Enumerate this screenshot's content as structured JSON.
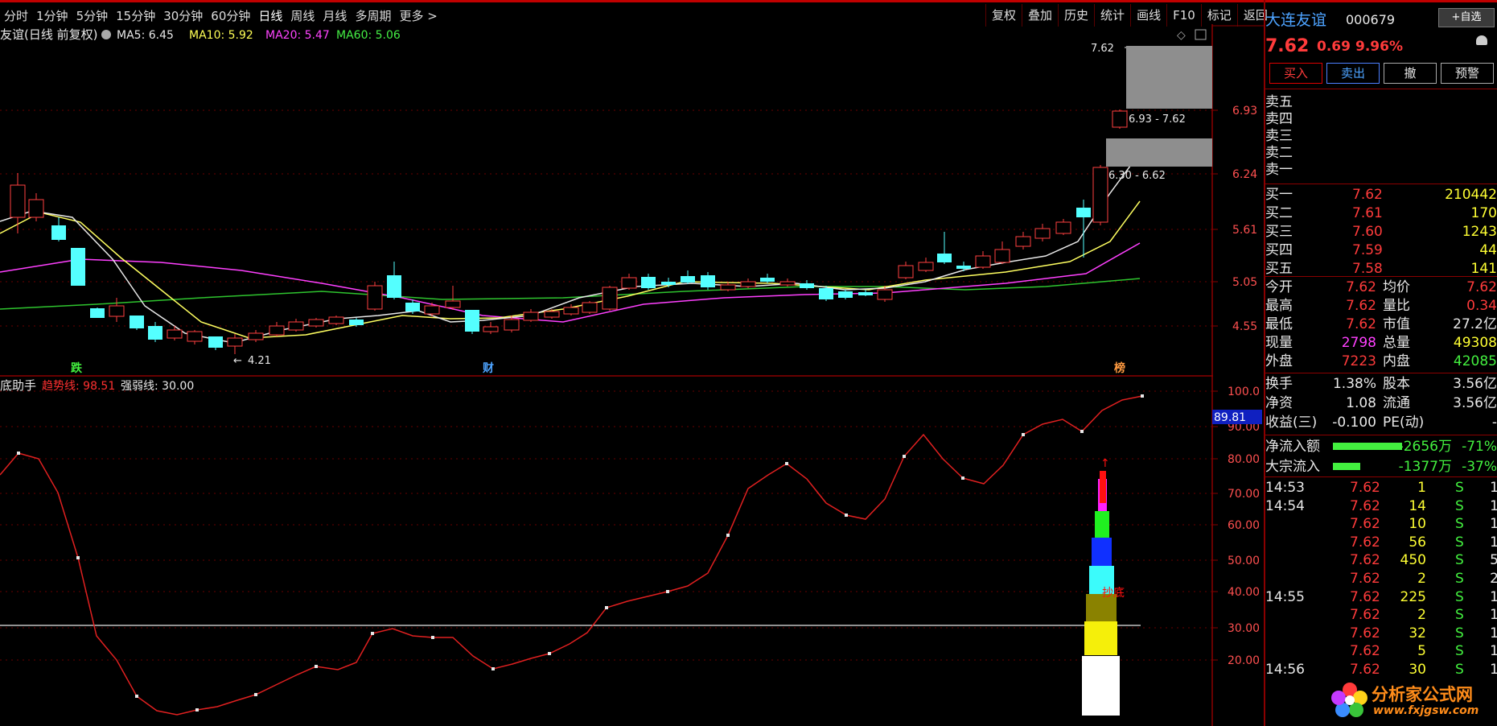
{
  "periods": [
    "分时",
    "1分钟",
    "5分钟",
    "15分钟",
    "30分钟",
    "60分钟",
    "日线",
    "周线",
    "月线",
    "多周期",
    "更多 >"
  ],
  "tools": [
    "复权",
    "叠加",
    "历史",
    "统计",
    "画线",
    "F10",
    "标记",
    "返回"
  ],
  "main": {
    "title": "友谊(日线 前复权)",
    "ma": [
      {
        "label": "MA5: 6.45",
        "color": "#e8e8e8"
      },
      {
        "label": "MA10: 5.92",
        "color": "#ffff55"
      },
      {
        "label": "MA20: 5.47",
        "color": "#ff44ff"
      },
      {
        "label": "MA60: 5.06",
        "color": "#44ee44"
      }
    ],
    "price_ticks": [
      "6.93",
      "6.24",
      "5.61",
      "5.05",
      "4.55"
    ],
    "low_label": "4.21",
    "high_label": "7.62",
    "zone1": "6.93 - 7.62",
    "zone2": "6.30 - 6.62",
    "events": [
      "跌",
      "财",
      "榜"
    ]
  },
  "sub": {
    "name": "底助手",
    "trend": "趋势线: 98.51",
    "strength": "强弱线: 30.00",
    "ticks": [
      "100.0",
      "90.00",
      "80.00",
      "70.00",
      "60.00",
      "50.00",
      "40.00",
      "30.00",
      "20.00"
    ],
    "current": "89.81",
    "label": "抄底"
  },
  "panel": {
    "name": "大连友谊",
    "code": "000679",
    "zixuan": "+自选",
    "price": "7.62",
    "change": "0.69",
    "pct": "9.96%",
    "buttons": [
      "买入",
      "卖出",
      "撤",
      "预警"
    ],
    "asks": [
      "卖五",
      "卖四",
      "卖三",
      "卖二",
      "卖一"
    ],
    "bids": [
      {
        "l": "买一",
        "p": "7.62",
        "v": "210442"
      },
      {
        "l": "买二",
        "p": "7.61",
        "v": "170"
      },
      {
        "l": "买三",
        "p": "7.60",
        "v": "1243"
      },
      {
        "l": "买四",
        "p": "7.59",
        "v": "44"
      },
      {
        "l": "买五",
        "p": "7.58",
        "v": "141"
      }
    ],
    "stats": [
      {
        "a": "今开",
        "b": "7.62",
        "c": "均价",
        "d": "7.62"
      },
      {
        "a": "最高",
        "b": "7.62",
        "c": "量比",
        "d": "0.34"
      },
      {
        "a": "最低",
        "b": "7.62",
        "c": "市值",
        "d": "27.2亿"
      },
      {
        "a": "现量",
        "b": "2798",
        "c": "总量",
        "d": "49308"
      },
      {
        "a": "外盘",
        "b": "7223",
        "c": "内盘",
        "d": "42085"
      }
    ],
    "stats2": [
      {
        "a": "换手",
        "b": "1.38%",
        "c": "股本",
        "d": "3.56亿"
      },
      {
        "a": "净资",
        "b": "1.08",
        "c": "流通",
        "d": "3.56亿"
      },
      {
        "a": "收益(三)",
        "b": "-0.100",
        "c": "PE(动)",
        "d": "-"
      }
    ],
    "flows": [
      {
        "l": "净流入额",
        "v": "-2656万",
        "p": "-71%"
      },
      {
        "l": "大宗流入",
        "v": "-1377万",
        "p": "-37%"
      }
    ],
    "ticks": [
      {
        "t": "14:53",
        "p": "7.62",
        "v": "1",
        "s": "S",
        "n": "1"
      },
      {
        "t": "14:54",
        "p": "7.62",
        "v": "14",
        "s": "S",
        "n": "1"
      },
      {
        "t": "",
        "p": "7.62",
        "v": "10",
        "s": "S",
        "n": "1"
      },
      {
        "t": "",
        "p": "7.62",
        "v": "56",
        "s": "S",
        "n": "1"
      },
      {
        "t": "",
        "p": "7.62",
        "v": "450",
        "s": "S",
        "n": "5"
      },
      {
        "t": "",
        "p": "7.62",
        "v": "2",
        "s": "S",
        "n": "2"
      },
      {
        "t": "14:55",
        "p": "7.62",
        "v": "225",
        "s": "S",
        "n": "1"
      },
      {
        "t": "",
        "p": "7.62",
        "v": "2",
        "s": "S",
        "n": "1"
      },
      {
        "t": "",
        "p": "7.62",
        "v": "32",
        "s": "S",
        "n": "1"
      },
      {
        "t": "",
        "p": "7.62",
        "v": "5",
        "s": "S",
        "n": "1"
      },
      {
        "t": "14:56",
        "p": "7.62",
        "v": "30",
        "s": "S",
        "n": "1"
      }
    ],
    "watermark": "分析家公式网",
    "watermark_url": "www.fxjgsw.com"
  }
}
